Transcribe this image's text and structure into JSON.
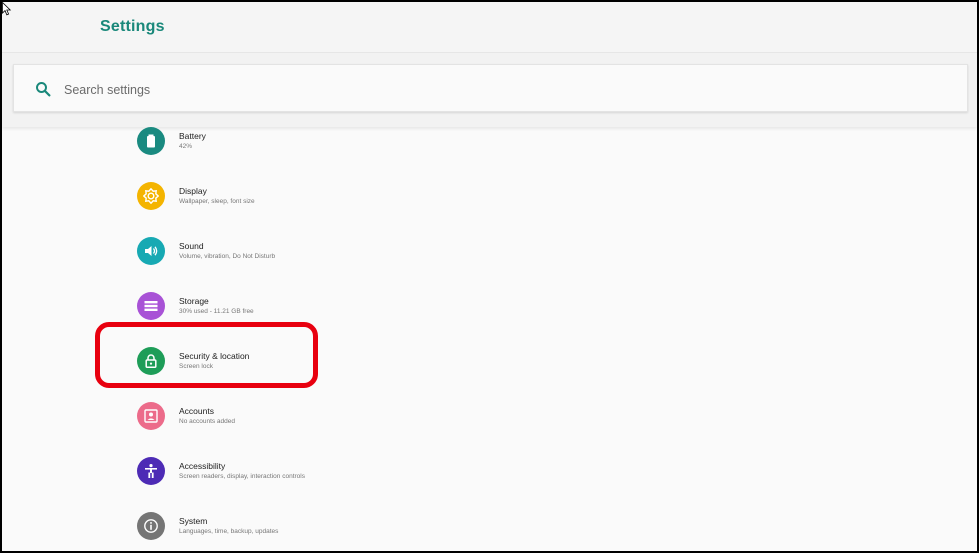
{
  "header": {
    "title": "Settings"
  },
  "search": {
    "placeholder": "Search settings"
  },
  "items": [
    {
      "label": "Battery",
      "sub": "42%",
      "icon": "battery-icon",
      "color": "#1a8a80"
    },
    {
      "label": "Display",
      "sub": "Wallpaper, sleep, font size",
      "icon": "brightness-icon",
      "color": "#f4b400"
    },
    {
      "label": "Sound",
      "sub": "Volume, vibration, Do Not Disturb",
      "icon": "volume-icon",
      "color": "#17a9b3"
    },
    {
      "label": "Storage",
      "sub": "30% used - 11.21 GB free",
      "icon": "storage-icon",
      "color": "#a852d6"
    },
    {
      "label": "Security & location",
      "sub": "Screen lock",
      "icon": "lock-icon",
      "color": "#1e9d58"
    },
    {
      "label": "Accounts",
      "sub": "No accounts added",
      "icon": "account-box-icon",
      "color": "#ec6b8a"
    },
    {
      "label": "Accessibility",
      "sub": "Screen readers, display, interaction controls",
      "icon": "accessibility-icon",
      "color": "#4d2bb5"
    },
    {
      "label": "System",
      "sub": "Languages, time, backup, updates",
      "icon": "info-icon",
      "color": "#757575"
    }
  ],
  "colors": {
    "accent": "#19887a",
    "highlight": "#e8000f"
  }
}
